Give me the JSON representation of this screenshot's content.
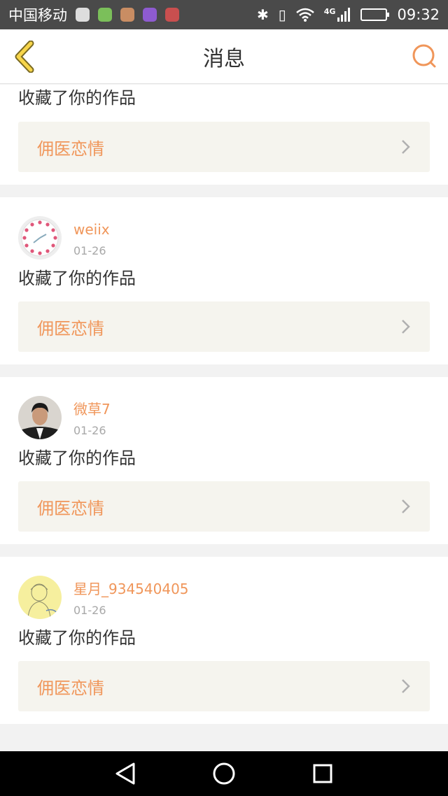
{
  "status_bar": {
    "carrier": "中国移动",
    "network": "4G",
    "time": "09:32",
    "notification_icons": [
      "app-icon-1",
      "app-icon-2",
      "app-icon-3",
      "gallery-icon",
      "app-icon-5"
    ]
  },
  "nav": {
    "title": "消息",
    "accent_color": "#f0965a"
  },
  "messages": [
    {
      "username": "",
      "date": "",
      "action": "收藏了你的作品",
      "work_title": "佣医恋情"
    },
    {
      "username": "weiix",
      "date": "01-26",
      "action": "收藏了你的作品",
      "work_title": "佣医恋情"
    },
    {
      "username": "微草7",
      "date": "01-26",
      "action": "收藏了你的作品",
      "work_title": "佣医恋情"
    },
    {
      "username": "星月_934540405",
      "date": "01-26",
      "action": "收藏了你的作品",
      "work_title": "佣医恋情"
    }
  ]
}
